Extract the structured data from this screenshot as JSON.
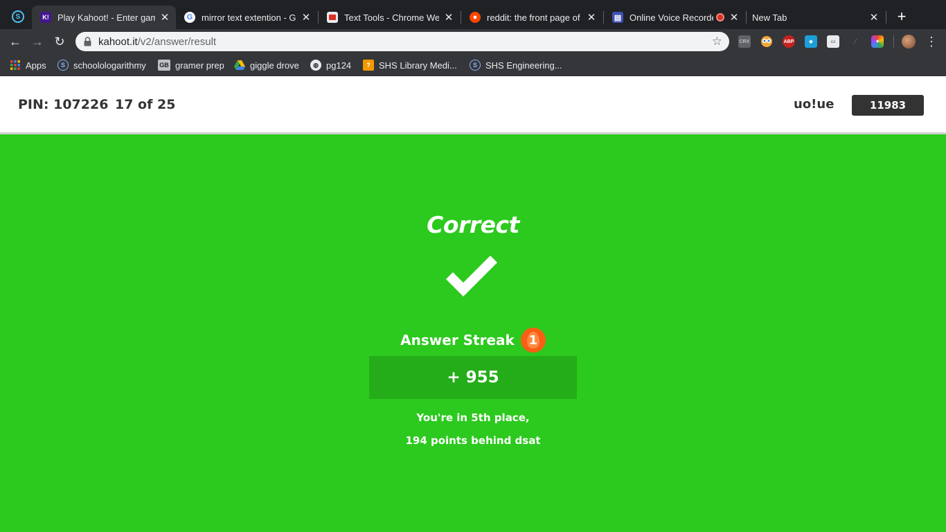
{
  "browser": {
    "tabs": [
      {
        "title": "Play Kahoot! - Enter game PIN here!",
        "icon": "kahoot-icon",
        "active": true
      },
      {
        "title": "mirror text extention - Google Search",
        "icon": "google-icon",
        "active": false
      },
      {
        "title": "Text Tools - Chrome Web Store",
        "icon": "text-tools-icon",
        "active": false
      },
      {
        "title": "reddit: the front page of the internet",
        "icon": "reddit-icon",
        "active": false
      },
      {
        "title": "Online Voice Recorder",
        "icon": "voice-recorder-icon",
        "active": false
      },
      {
        "title": "New Tab",
        "icon": "",
        "active": false
      }
    ],
    "address": {
      "host": "kahoot.it",
      "path": "/v2/answer/result"
    },
    "bookmarks": [
      {
        "label": "Apps",
        "icon": "apps-grid-icon"
      },
      {
        "label": "schoolologarithmy",
        "icon": "schoology-icon"
      },
      {
        "label": "gramer prep",
        "icon": "gb-icon"
      },
      {
        "label": "giggle drove",
        "icon": "drive-icon"
      },
      {
        "label": "pg124",
        "icon": "globe-icon"
      },
      {
        "label": "SHS Library Medi...",
        "icon": "library-icon"
      },
      {
        "label": "SHS Engineering...",
        "icon": "schoology-icon"
      }
    ],
    "extensions": [
      {
        "label": "CRX",
        "icon": "crx-icon"
      },
      {
        "label": "",
        "icon": "owl-icon"
      },
      {
        "label": "ABP",
        "icon": "adblock-icon"
      },
      {
        "label": "",
        "icon": "extension-blue-icon"
      },
      {
        "label": "",
        "icon": "briefcase-icon"
      },
      {
        "label": "",
        "icon": "color-picker-icon"
      }
    ]
  },
  "game": {
    "pin_label": "PIN: 107226",
    "progress_label": "17 of 25",
    "nickname": "uo!ue",
    "score": "11983"
  },
  "result": {
    "title": "Correct",
    "streak_label": "Answer Streak",
    "streak_count": "1",
    "points": "+ 955",
    "place_text": "You're in 5th place,",
    "behind_text": "194 points behind dsat"
  },
  "colors": {
    "correct_bg": "#2cc91e",
    "points_bg": "#25ad19",
    "streak_badge": "#f85f14",
    "score_bg": "#333333"
  }
}
